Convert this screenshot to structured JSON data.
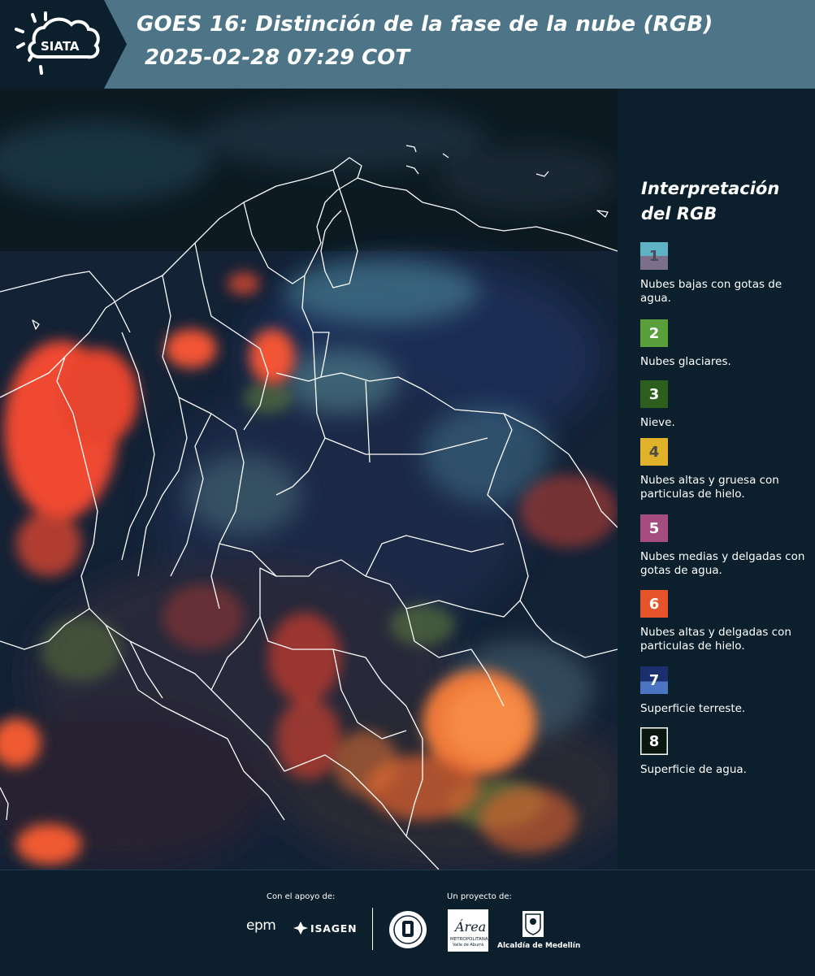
{
  "header": {
    "logo_text": "SIATA",
    "title_line1": "GOES 16: Distinción de la fase de la nube (RGB)",
    "title_line2": "2025-02-28 07:29 COT",
    "band_color": "#4d7587"
  },
  "legend": {
    "title": "Interpretación del RGB",
    "items": [
      {
        "number": "1",
        "label": "Nubes bajas con gotas de agua.",
        "color_top": "#5fb2c4",
        "color_bottom": "#7b6f8c",
        "number_color": "#4a4a5a"
      },
      {
        "number": "2",
        "label": "Nubes glaciares.",
        "color_top": "#5aa03a",
        "color_bottom": "#5aa03a",
        "number_color": "#ffffff"
      },
      {
        "number": "3",
        "label": "Nieve.",
        "color_top": "#2e5e1e",
        "color_bottom": "#2e5e1e",
        "number_color": "#ffffff"
      },
      {
        "number": "4",
        "label": "Nubes altas y gruesa con particulas de hielo.",
        "color_top": "#e0b22a",
        "color_bottom": "#e0b22a",
        "number_color": "#4a4a4a"
      },
      {
        "number": "5",
        "label": "Nubes medias y delgadas con gotas de agua.",
        "color_top": "#a64d7f",
        "color_bottom": "#a64d7f",
        "number_color": "#ffffff"
      },
      {
        "number": "6",
        "label": "Nubes altas y delgadas con particulas de hielo.",
        "color_top": "#e8542a",
        "color_bottom": "#e8542a",
        "number_color": "#ffffff"
      },
      {
        "number": "7",
        "label": "Superficie terreste.",
        "color_top": "#1b2e6e",
        "color_bottom": "#4c74c2",
        "number_color": "#ffffff"
      },
      {
        "number": "8",
        "label": "Superficie de agua.",
        "color_top": "#0a1710",
        "color_bottom": "#0a1710",
        "number_color": "#ffffff"
      }
    ]
  },
  "footer": {
    "support_label": "Con el apoyo de:",
    "project_label": "Un proyecto de:",
    "epm": "epm",
    "isagen": "ISAGEN",
    "area": "Área",
    "area_sub1": "METROPOLITANA",
    "area_sub2": "Valle de Aburrá",
    "medellin": "Alcaldía de Medellín"
  }
}
